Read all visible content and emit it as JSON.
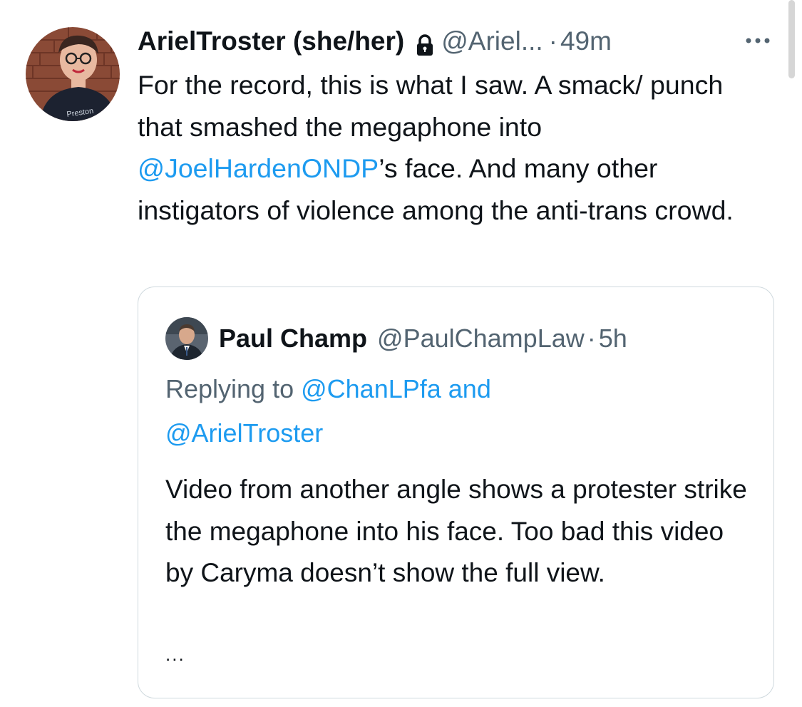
{
  "tweet": {
    "author_name": "ArielTroster (she/her)",
    "handle": "@Ariel...",
    "separator": "·",
    "time": "49m",
    "lock_icon": "lock-icon",
    "more_icon": "more-horizontal-icon",
    "text_before_mention": "For the record, this is what I saw. A smack/ punch that smashed the megaphone into ",
    "mention": "@JoelHardenONDP",
    "text_after_mention": "’s face. And many other instigators of violence among the anti-trans crowd.",
    "avatar_shirt_text": "Preston"
  },
  "quote": {
    "author_name": "Paul Champ",
    "handle": "@PaulChampLaw",
    "separator": "·",
    "time": "5h",
    "replying_prefix": "Replying to ",
    "reply_mention_1": "@ChanLPfa",
    "reply_and": " and",
    "reply_mention_2": "@ArielTroster",
    "text": "Video from another angle shows a protester strike the megaphone into his face. Too bad this video by Caryma doesn’t show the full view.",
    "truncation": "..."
  },
  "colors": {
    "link": "#1d9bf0",
    "secondary_text": "#536471",
    "primary_text": "#0f1419",
    "card_border": "#cfd9de"
  }
}
